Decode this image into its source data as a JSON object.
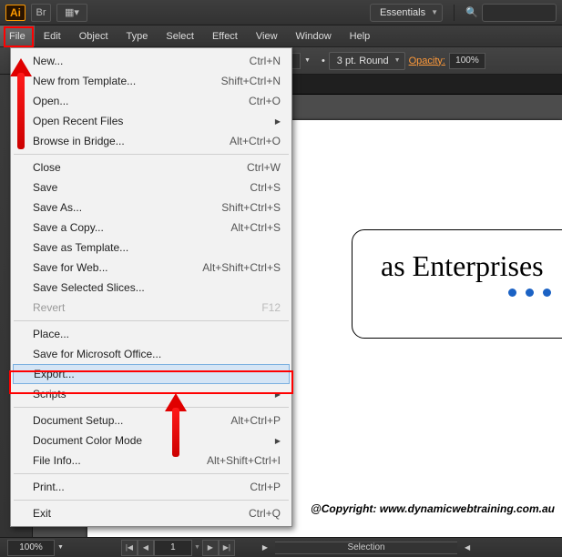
{
  "app": {
    "name": "Adobe Illustrator",
    "logo": "Ai"
  },
  "topbar": {
    "workspace": "Essentials"
  },
  "menubar": [
    "File",
    "Edit",
    "Object",
    "Type",
    "Select",
    "Effect",
    "View",
    "Window",
    "Help"
  ],
  "stroke_preset": "3 pt. Round",
  "opacity": {
    "label": "Opacity:",
    "value": "100%"
  },
  "file_menu": {
    "groups": [
      [
        {
          "label": "New...",
          "shortcut": "Ctrl+N"
        },
        {
          "label": "New from Template...",
          "shortcut": "Shift+Ctrl+N"
        },
        {
          "label": "Open...",
          "shortcut": "Ctrl+O"
        },
        {
          "label": "Open Recent Files",
          "submenu": true
        },
        {
          "label": "Browse in Bridge...",
          "shortcut": "Alt+Ctrl+O"
        }
      ],
      [
        {
          "label": "Close",
          "shortcut": "Ctrl+W"
        },
        {
          "label": "Save",
          "shortcut": "Ctrl+S"
        },
        {
          "label": "Save As...",
          "shortcut": "Shift+Ctrl+S"
        },
        {
          "label": "Save a Copy...",
          "shortcut": "Alt+Ctrl+S"
        },
        {
          "label": "Save as Template..."
        },
        {
          "label": "Save for Web...",
          "shortcut": "Alt+Shift+Ctrl+S"
        },
        {
          "label": "Save Selected Slices..."
        },
        {
          "label": "Revert",
          "shortcut": "F12",
          "disabled": true
        }
      ],
      [
        {
          "label": "Place..."
        },
        {
          "label": "Save for Microsoft Office..."
        },
        {
          "label": "Export...",
          "highlight": true
        },
        {
          "label": "Scripts",
          "submenu": true
        }
      ],
      [
        {
          "label": "Document Setup...",
          "shortcut": "Alt+Ctrl+P"
        },
        {
          "label": "Document Color Mode",
          "submenu": true
        },
        {
          "label": "File Info...",
          "shortcut": "Alt+Shift+Ctrl+I"
        }
      ],
      [
        {
          "label": "Print...",
          "shortcut": "Ctrl+P"
        }
      ],
      [
        {
          "label": "Exit",
          "shortcut": "Ctrl+Q"
        }
      ]
    ]
  },
  "document": {
    "logo_text": "as Enterprises",
    "copyright": "@Copyright: www.dynamicwebtraining.com.au"
  },
  "status": {
    "zoom": "100%",
    "page": "1",
    "selection_label": "Selection"
  }
}
